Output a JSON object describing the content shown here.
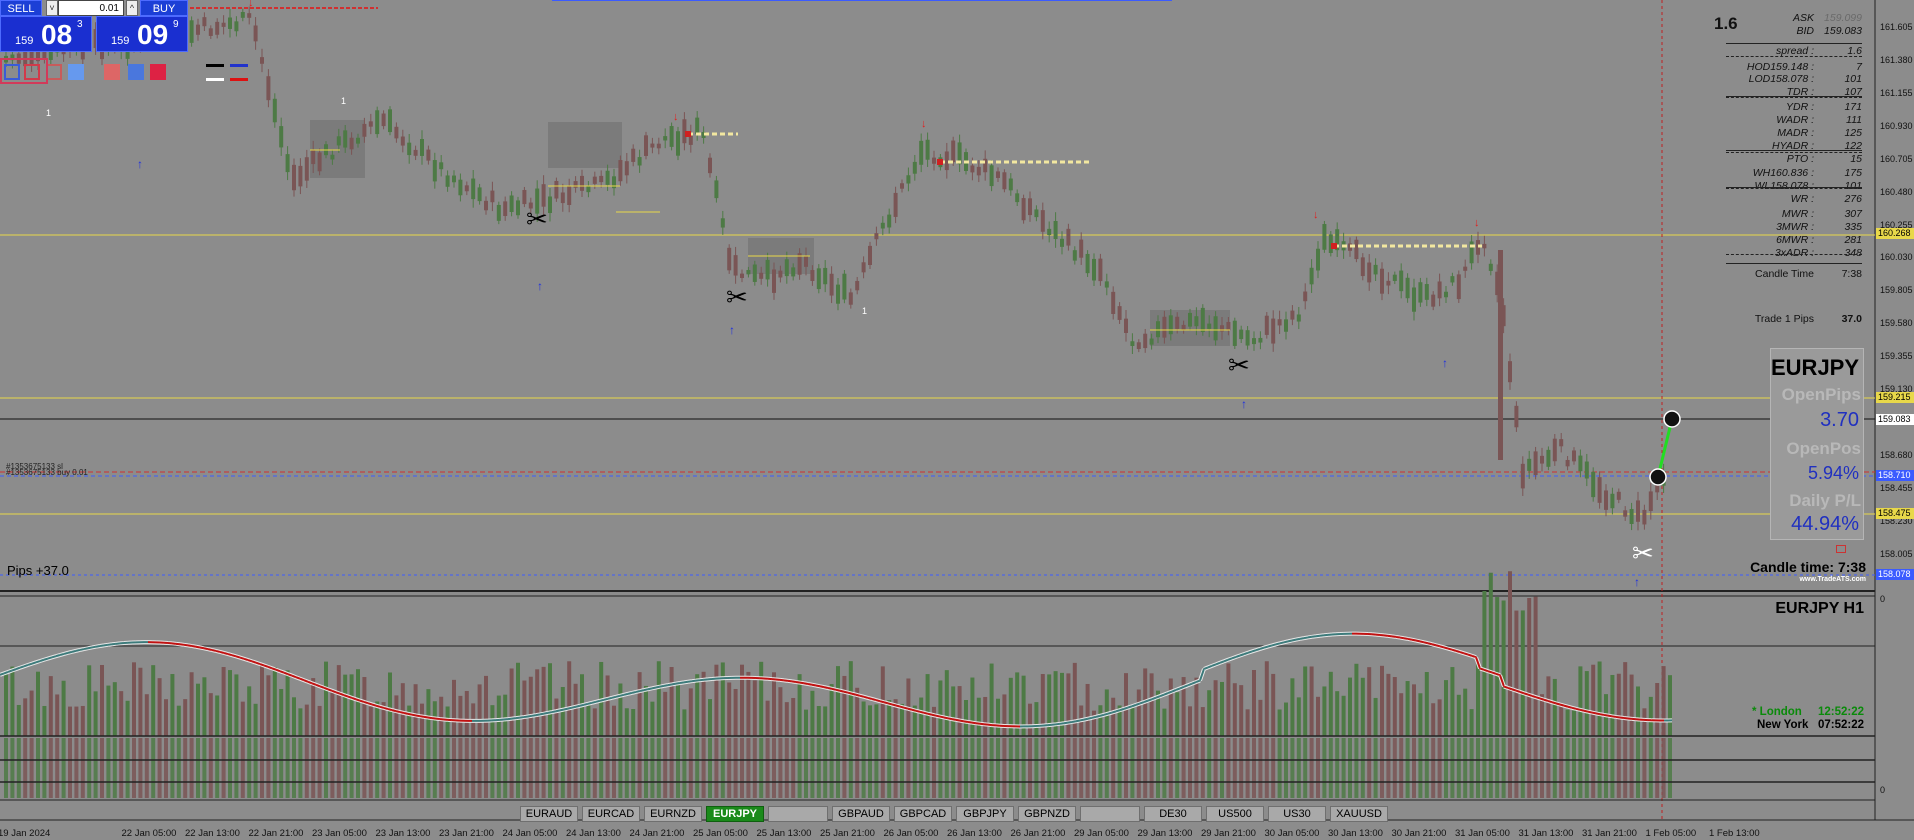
{
  "trade_panel": {
    "sell_label": "SELL",
    "buy_label": "BUY",
    "lot_value": "0.01",
    "step_down": "˅",
    "step_up": "^",
    "bid": {
      "prefix": "159",
      "main": "08",
      "pip": "3"
    },
    "ask": {
      "prefix": "159",
      "main": "09",
      "pip": "9"
    }
  },
  "swatches": [
    "#3a5bd8",
    "#d23a4a",
    "#c85b5b",
    "#6699ee",
    "#dd6666",
    "#4a77dd",
    "#dd2244"
  ],
  "info_panel": {
    "spread_big": "1.6",
    "rows": [
      {
        "label": "ASK",
        "value": "159.099"
      },
      {
        "label": "BID",
        "value": "159.083"
      },
      {
        "label": "spread :",
        "value": "1.6"
      },
      {
        "label": "HOD159.148 :",
        "value": "7"
      },
      {
        "label": "LOD158.078 :",
        "value": "101"
      },
      {
        "label": "TDR :",
        "value": "107"
      },
      {
        "label": "YDR :",
        "value": "171"
      },
      {
        "label": "WADR :",
        "value": "111"
      },
      {
        "label": "MADR :",
        "value": "125"
      },
      {
        "label": "HYADR :",
        "value": "122"
      },
      {
        "label": "PTO :",
        "value": "15"
      },
      {
        "label": "WH160.836 :",
        "value": "175"
      },
      {
        "label": "WL158.078 :",
        "value": "101"
      },
      {
        "label": "WR :",
        "value": "276"
      },
      {
        "label": "MWR :",
        "value": "307"
      },
      {
        "label": "3MWR :",
        "value": "335"
      },
      {
        "label": "6MWR :",
        "value": "281"
      },
      {
        "label": "3xADR :",
        "value": "348"
      },
      {
        "label": "Candle Time",
        "value": "7:38"
      },
      {
        "label": "Trade 1 Pips",
        "value": "37.0"
      }
    ]
  },
  "symbol_panel": {
    "symbol": "EURJPY",
    "open_pips_label": "OpenPips",
    "open_pips_value": "3.70",
    "open_pos_label": "OpenPos",
    "open_pos_value": "5.94%",
    "daily_pl_label": "Daily P/L",
    "daily_pl_value": "44.94%"
  },
  "candle_time": "Candle time:  7:38",
  "branding": "www.TradeATS.com",
  "pips_label": "Pips +37.0",
  "order_label": "#1353675133 sl",
  "order_label2": "#1353675133 buy 0.01",
  "subwindow_title": "EURJPY  H1",
  "sessions": {
    "london_label": "* London",
    "london_time": "12:52:22",
    "newyork_label": "New York",
    "newyork_time": "07:52:22"
  },
  "sub_axis": {
    "top": "0",
    "bottom": "0"
  },
  "price_axis": [
    "161.605",
    "161.380",
    "161.155",
    "160.930",
    "160.705",
    "160.480",
    "160.255",
    "160.030",
    "159.805",
    "159.580",
    "159.355",
    "159.130",
    "158.905",
    "158.680",
    "158.455",
    "158.230",
    "158.005"
  ],
  "axis_tags": [
    {
      "value": "160.268",
      "color": "#e8d84a"
    },
    {
      "value": "159.215",
      "color": "#e8d84a"
    },
    {
      "value": "159.083",
      "color": "#ffffff"
    },
    {
      "value": "158.710",
      "color": "#3b5bff"
    },
    {
      "value": "158.475",
      "color": "#e8d84a"
    },
    {
      "value": "158.078",
      "color": "#3b5bff"
    }
  ],
  "time_axis": [
    "19 Jan 2024",
    "22 Jan 05:00",
    "22 Jan 13:00",
    "22 Jan 21:00",
    "23 Jan 05:00",
    "23 Jan 13:00",
    "23 Jan 21:00",
    "24 Jan 05:00",
    "24 Jan 13:00",
    "24 Jan 21:00",
    "25 Jan 05:00",
    "25 Jan 13:00",
    "25 Jan 21:00",
    "26 Jan 05:00",
    "26 Jan 13:00",
    "26 Jan 21:00",
    "29 Jan 05:00",
    "29 Jan 13:00",
    "29 Jan 21:00",
    "30 Jan 05:00",
    "30 Jan 13:00",
    "30 Jan 21:00",
    "31 Jan 05:00",
    "31 Jan 13:00",
    "31 Jan 21:00",
    "1 Feb 05:00",
    "1 Feb 13:00"
  ],
  "symbol_tabs": [
    "EURAUD",
    "EURCAD",
    "EURNZD",
    "EURJPY",
    "",
    "GBPAUD",
    "GBPCAD",
    "GBPJPY",
    "GBPNZD",
    "",
    "DE30",
    "US500",
    "US30",
    "XAUUSD"
  ],
  "active_tab": "EURJPY",
  "colors": {
    "background": "#8c8c8c",
    "bull": "#4d7a45",
    "bear": "#7a5555",
    "level_line": "#e8d84a",
    "ma_bull": "#3b7a7a",
    "ma_bear": "#c01010"
  }
}
